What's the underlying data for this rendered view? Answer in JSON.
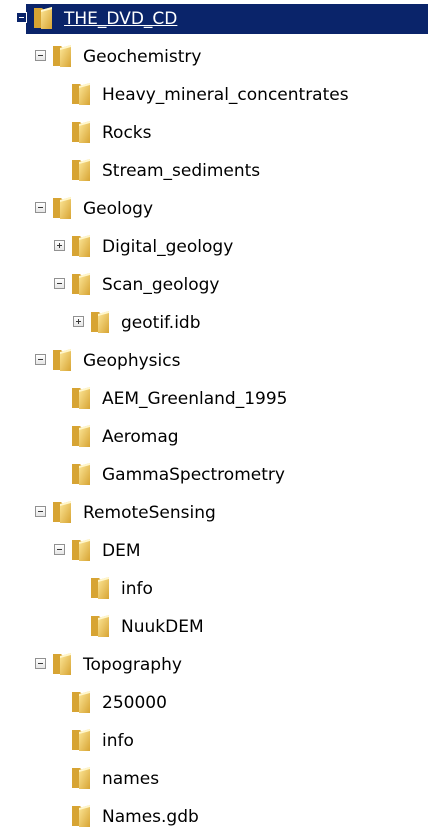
{
  "tree": {
    "nodes": [
      {
        "label": "THE_DVD_CD",
        "level": 0,
        "toggle": "minus",
        "selected": true
      },
      {
        "label": "Geochemistry",
        "level": 1,
        "toggle": "minus"
      },
      {
        "label": "Heavy_mineral_concentrates",
        "level": 2,
        "toggle": "none"
      },
      {
        "label": "Rocks",
        "level": 2,
        "toggle": "none"
      },
      {
        "label": "Stream_sediments",
        "level": 2,
        "toggle": "none"
      },
      {
        "label": "Geology",
        "level": 1,
        "toggle": "minus"
      },
      {
        "label": "Digital_geology",
        "level": 2,
        "toggle": "plus"
      },
      {
        "label": "Scan_geology",
        "level": 2,
        "toggle": "minus"
      },
      {
        "label": "geotif.idb",
        "level": 3,
        "toggle": "plus"
      },
      {
        "label": "Geophysics",
        "level": 1,
        "toggle": "minus"
      },
      {
        "label": "AEM_Greenland_1995",
        "level": 2,
        "toggle": "none"
      },
      {
        "label": "Aeromag",
        "level": 2,
        "toggle": "none"
      },
      {
        "label": "GammaSpectrometry",
        "level": 2,
        "toggle": "none"
      },
      {
        "label": "RemoteSensing",
        "level": 1,
        "toggle": "minus"
      },
      {
        "label": "DEM",
        "level": 2,
        "toggle": "minus"
      },
      {
        "label": "info",
        "level": 3,
        "toggle": "none"
      },
      {
        "label": "NuukDEM",
        "level": 3,
        "toggle": "none"
      },
      {
        "label": "Topography",
        "level": 1,
        "toggle": "minus"
      },
      {
        "label": "250000",
        "level": 2,
        "toggle": "none"
      },
      {
        "label": "info",
        "level": 2,
        "toggle": "none"
      },
      {
        "label": "names",
        "level": 2,
        "toggle": "none"
      },
      {
        "label": "Names.gdb",
        "level": 2,
        "toggle": "none"
      }
    ]
  },
  "colors": {
    "selection_background": "#0a246a",
    "selection_text": "#ffffff",
    "folder_light": "#fde89a",
    "folder_dark": "#d7a433",
    "text": "#000000"
  }
}
